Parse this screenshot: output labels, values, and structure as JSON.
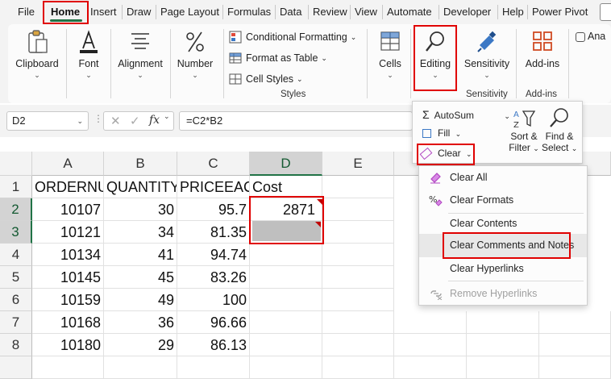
{
  "tabs": [
    {
      "label": "File"
    },
    {
      "label": "Home"
    },
    {
      "label": "Insert"
    },
    {
      "label": "Draw"
    },
    {
      "label": "Page Layout"
    },
    {
      "label": "Formulas"
    },
    {
      "label": "Data"
    },
    {
      "label": "Review"
    },
    {
      "label": "View"
    },
    {
      "label": "Automate"
    },
    {
      "label": "Developer"
    },
    {
      "label": "Help"
    },
    {
      "label": "Power Pivot"
    }
  ],
  "ribbon": {
    "clipboard": "Clipboard",
    "font": "Font",
    "alignment": "Alignment",
    "number": "Number",
    "conditional_formatting": "Conditional Formatting",
    "format_as_table": "Format as Table",
    "cell_styles": "Cell Styles",
    "styles_group": "Styles",
    "cells": "Cells",
    "editing": "Editing",
    "sensitivity": "Sensitivity",
    "sensitivity_group": "Sensitivity",
    "addins": "Add-ins",
    "addins_group": "Add-ins",
    "analyze_partial": "Ana"
  },
  "formula_bar": {
    "name_box": "D2",
    "fx": "fx",
    "formula": "=C2*B2"
  },
  "sheet": {
    "columns": [
      "A",
      "B",
      "C",
      "D",
      "E"
    ],
    "rows": [
      "1",
      "2",
      "3",
      "4",
      "5",
      "6",
      "7",
      "8"
    ],
    "header_row": [
      "ORDERNUMBER",
      "QUANTITY",
      "PRICEEACH",
      "Cost"
    ],
    "data": [
      [
        "10107",
        "30",
        "95.7",
        "2871"
      ],
      [
        "10121",
        "34",
        "81.35",
        ""
      ],
      [
        "10134",
        "41",
        "94.74",
        ""
      ],
      [
        "10145",
        "45",
        "83.26",
        ""
      ],
      [
        "10159",
        "49",
        "100",
        ""
      ],
      [
        "10168",
        "36",
        "96.66",
        ""
      ],
      [
        "10180",
        "29",
        "86.13",
        ""
      ]
    ]
  },
  "editing_menu": {
    "autosum": "AutoSum",
    "fill": "Fill",
    "clear": "Clear",
    "sort_filter_1": "Sort &",
    "sort_filter_2": "Filter",
    "find_select_1": "Find &",
    "find_select_2": "Select"
  },
  "clear_menu": [
    {
      "label": "Clear All",
      "icon": "eraser-icon"
    },
    {
      "label": "Clear Formats",
      "icon": "percent-eraser-icon"
    },
    {
      "label": "Clear Contents",
      "icon": ""
    },
    {
      "label": "Clear Comments and Notes",
      "icon": ""
    },
    {
      "label": "Clear Hyperlinks",
      "icon": ""
    },
    {
      "label": "Remove Hyperlinks",
      "icon": "link-remove-icon"
    }
  ],
  "colors": {
    "accent_green": "#217346",
    "highlight_red": "#e00000",
    "eraser_purple": "#b146c2"
  }
}
